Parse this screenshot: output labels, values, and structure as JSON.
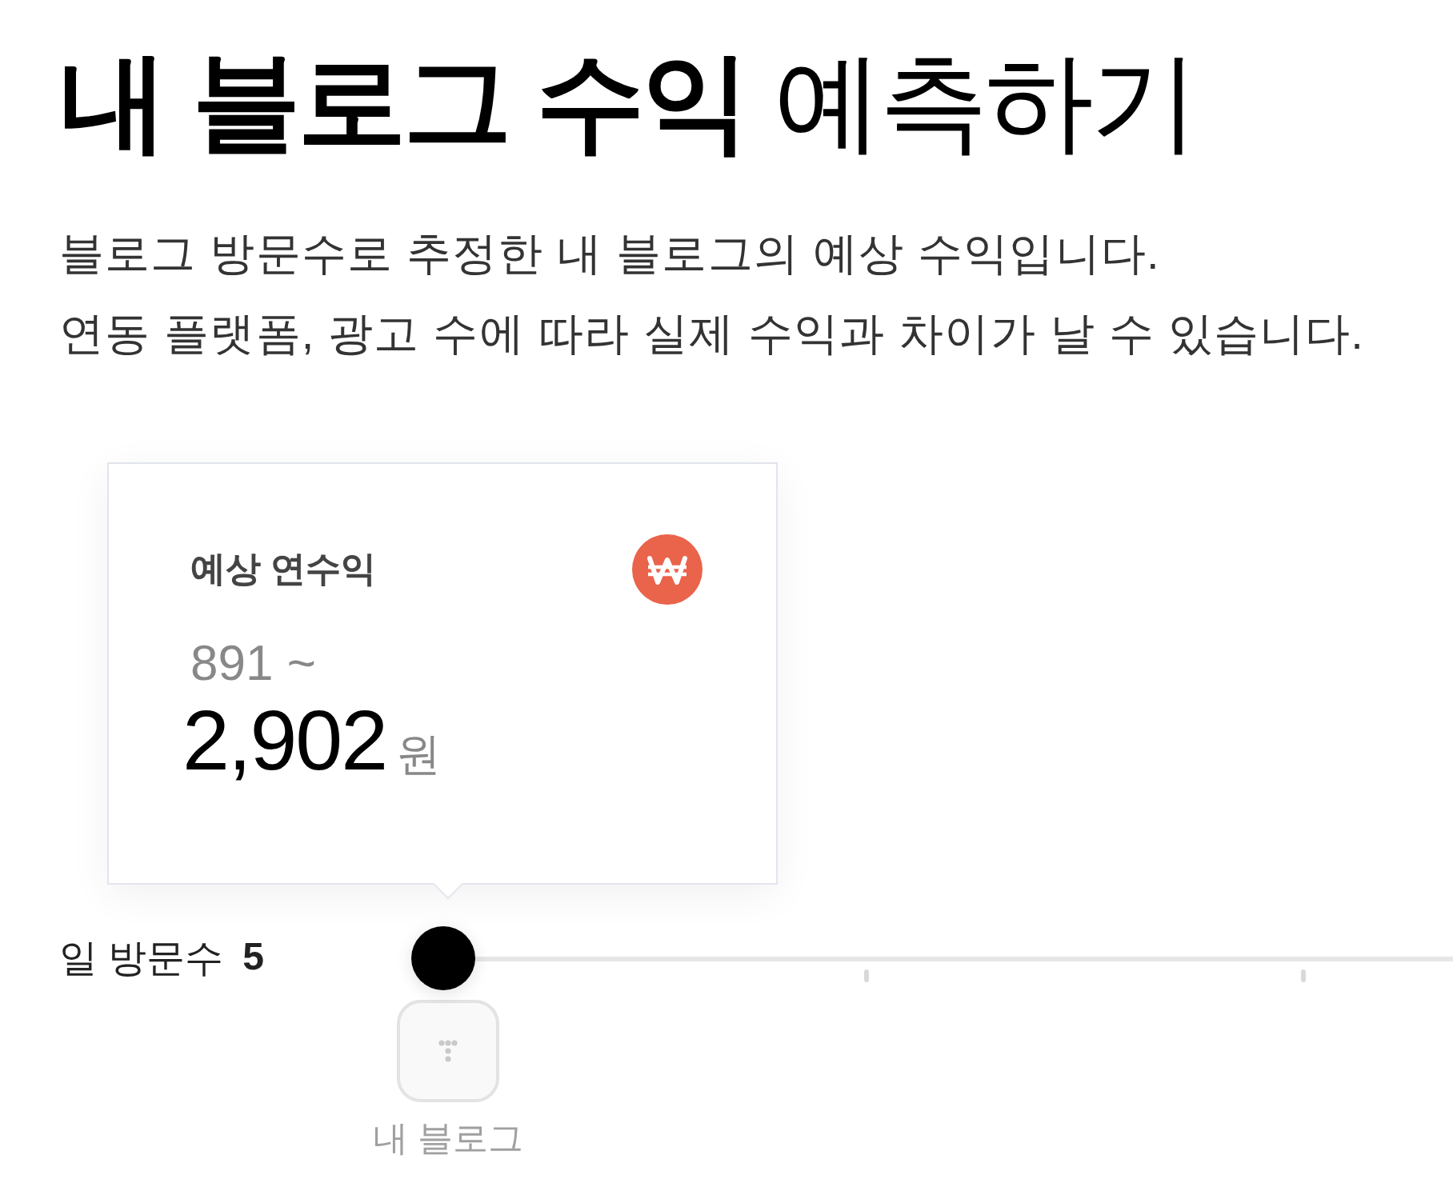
{
  "title": "**내 블로그 수익** 예측하기",
  "description": [
    "블로그 방문수로 추정한 내 블로그의 예상 수익입니다.",
    "연동 플랫폼, 광고 수에 따라 실제 수익과 차이가 날 수 있습니다."
  ],
  "estimate_card": {
    "label": "예상 연수익",
    "range_min": "891 ~",
    "range_max": "2,902",
    "unit": "원"
  },
  "visits_slider": {
    "label": "일 방문수",
    "value": "5",
    "level": 0,
    "marker": {
      "label": "내 블로그"
    }
  }
}
